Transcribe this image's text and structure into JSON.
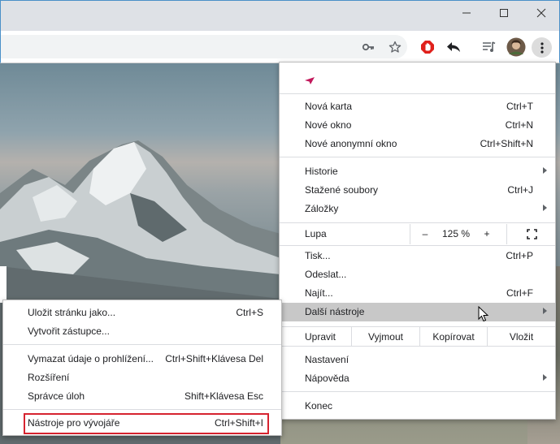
{
  "menu": {
    "new_tab": {
      "label": "Nová karta",
      "shortcut": "Ctrl+T"
    },
    "new_window": {
      "label": "Nové okno",
      "shortcut": "Ctrl+N"
    },
    "incognito": {
      "label": "Nové anonymní okno",
      "shortcut": "Ctrl+Shift+N"
    },
    "history": {
      "label": "Historie"
    },
    "downloads": {
      "label": "Stažené soubory",
      "shortcut": "Ctrl+J"
    },
    "bookmarks": {
      "label": "Záložky"
    },
    "zoom": {
      "label": "Lupa",
      "minus": "–",
      "value": "125 %",
      "plus": "+"
    },
    "print": {
      "label": "Tisk...",
      "shortcut": "Ctrl+P"
    },
    "cast": {
      "label": "Odeslat..."
    },
    "find": {
      "label": "Najít...",
      "shortcut": "Ctrl+F"
    },
    "more_tools": {
      "label": "Další nástroje"
    },
    "edit": {
      "label": "Upravit",
      "cut": "Vyjmout",
      "copy": "Kopírovat",
      "paste": "Vložit"
    },
    "settings": {
      "label": "Nastavení"
    },
    "help": {
      "label": "Nápověda"
    },
    "exit": {
      "label": "Konec"
    }
  },
  "submenu": {
    "save_page": {
      "label": "Uložit stránku jako...",
      "shortcut": "Ctrl+S"
    },
    "create_shortcut": {
      "label": "Vytvořit zástupce..."
    },
    "clear_data": {
      "label": "Vymazat údaje o prohlížení...",
      "shortcut": "Ctrl+Shift+Klávesa Del"
    },
    "extensions": {
      "label": "Rozšíření"
    },
    "task_manager": {
      "label": "Správce úloh",
      "shortcut": "Shift+Klávesa Esc"
    },
    "dev_tools": {
      "label": "Nástroje pro vývojáře",
      "shortcut": "Ctrl+Shift+I"
    }
  },
  "colors": {
    "highlight_border": "#d6232f",
    "hover_bg": "#c8c8c8",
    "adblock_red": "#e0201b"
  },
  "icons": [
    "minimize-icon",
    "maximize-icon",
    "close-icon",
    "key-icon",
    "star-icon",
    "adblock-icon",
    "back-share-icon",
    "media-icon",
    "avatar",
    "kebab-menu-icon",
    "fullscreen-icon",
    "pointer-cursor-icon"
  ]
}
